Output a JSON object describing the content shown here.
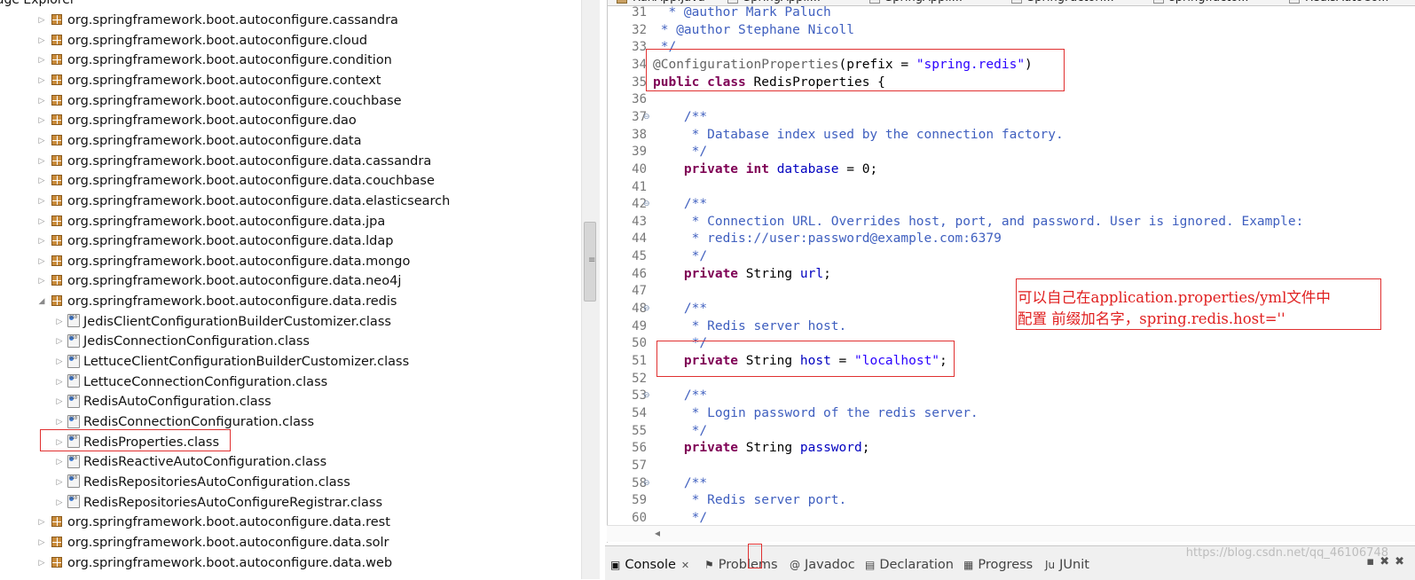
{
  "left_panel": {
    "title": "kage Explorer",
    "tree": [
      {
        "label": "org.springframework.boot.autoconfigure.cassandra",
        "kind": "package",
        "expanded": false
      },
      {
        "label": "org.springframework.boot.autoconfigure.cloud",
        "kind": "package",
        "expanded": false
      },
      {
        "label": "org.springframework.boot.autoconfigure.condition",
        "kind": "package",
        "expanded": false
      },
      {
        "label": "org.springframework.boot.autoconfigure.context",
        "kind": "package",
        "expanded": false
      },
      {
        "label": "org.springframework.boot.autoconfigure.couchbase",
        "kind": "package",
        "expanded": false
      },
      {
        "label": "org.springframework.boot.autoconfigure.dao",
        "kind": "package",
        "expanded": false
      },
      {
        "label": "org.springframework.boot.autoconfigure.data",
        "kind": "package",
        "expanded": false
      },
      {
        "label": "org.springframework.boot.autoconfigure.data.cassandra",
        "kind": "package",
        "expanded": false
      },
      {
        "label": "org.springframework.boot.autoconfigure.data.couchbase",
        "kind": "package",
        "expanded": false
      },
      {
        "label": "org.springframework.boot.autoconfigure.data.elasticsearch",
        "kind": "package",
        "expanded": false
      },
      {
        "label": "org.springframework.boot.autoconfigure.data.jpa",
        "kind": "package",
        "expanded": false
      },
      {
        "label": "org.springframework.boot.autoconfigure.data.ldap",
        "kind": "package",
        "expanded": false
      },
      {
        "label": "org.springframework.boot.autoconfigure.data.mongo",
        "kind": "package",
        "expanded": false
      },
      {
        "label": "org.springframework.boot.autoconfigure.data.neo4j",
        "kind": "package",
        "expanded": false
      },
      {
        "label": "org.springframework.boot.autoconfigure.data.redis",
        "kind": "package",
        "expanded": true
      },
      {
        "label": "JedisClientConfigurationBuilderCustomizer.class",
        "kind": "class",
        "expanded": false
      },
      {
        "label": "JedisConnectionConfiguration.class",
        "kind": "class",
        "expanded": false
      },
      {
        "label": "LettuceClientConfigurationBuilderCustomizer.class",
        "kind": "class",
        "expanded": false
      },
      {
        "label": "LettuceConnectionConfiguration.class",
        "kind": "class",
        "expanded": false
      },
      {
        "label": "RedisAutoConfiguration.class",
        "kind": "class",
        "expanded": false
      },
      {
        "label": "RedisConnectionConfiguration.class",
        "kind": "class",
        "expanded": false
      },
      {
        "label": "RedisProperties.class",
        "kind": "class",
        "expanded": false
      },
      {
        "label": "RedisReactiveAutoConfiguration.class",
        "kind": "class",
        "expanded": false
      },
      {
        "label": "RedisRepositoriesAutoConfiguration.class",
        "kind": "class",
        "expanded": false
      },
      {
        "label": "RedisRepositoriesAutoConfigureRegistrar.class",
        "kind": "class",
        "expanded": false
      },
      {
        "label": "org.springframework.boot.autoconfigure.data.rest",
        "kind": "package",
        "expanded": false
      },
      {
        "label": "org.springframework.boot.autoconfigure.data.solr",
        "kind": "package",
        "expanded": false
      },
      {
        "label": "org.springframework.boot.autoconfigure.data.web",
        "kind": "package",
        "expanded": false
      }
    ]
  },
  "editor": {
    "tabs": [
      "RunApp.java",
      "SpringAppli...",
      "SpringAppli...",
      "SpringFactori...",
      "spring.facto...",
      "RedisAutoCo..."
    ],
    "lines": [
      {
        "n": "31",
        "fold": false,
        "tokens": [
          {
            "t": "  * @author Mark Paluch",
            "c": "cm"
          }
        ]
      },
      {
        "n": "32",
        "fold": false,
        "tokens": [
          {
            "t": " * @author Stephane Nicoll",
            "c": "cm"
          }
        ]
      },
      {
        "n": "33",
        "fold": false,
        "tokens": [
          {
            "t": " */",
            "c": "cm"
          }
        ]
      },
      {
        "n": "34",
        "fold": false,
        "tokens": [
          {
            "t": "@ConfigurationProperties",
            "c": "ann"
          },
          {
            "t": "(prefix = ",
            "c": ""
          },
          {
            "t": "\"spring.redis\"",
            "c": "str"
          },
          {
            "t": ")",
            "c": ""
          }
        ]
      },
      {
        "n": "35",
        "fold": false,
        "tokens": [
          {
            "t": "public",
            "c": "kw"
          },
          {
            "t": " ",
            "c": ""
          },
          {
            "t": "class",
            "c": "kw"
          },
          {
            "t": " RedisProperties {",
            "c": ""
          }
        ]
      },
      {
        "n": "36",
        "fold": false,
        "tokens": []
      },
      {
        "n": "37",
        "fold": true,
        "tokens": [
          {
            "t": "    /**",
            "c": "cm"
          }
        ]
      },
      {
        "n": "38",
        "fold": false,
        "tokens": [
          {
            "t": "     * Database index used by the connection factory.",
            "c": "cm"
          }
        ]
      },
      {
        "n": "39",
        "fold": false,
        "tokens": [
          {
            "t": "     */",
            "c": "cm"
          }
        ]
      },
      {
        "n": "40",
        "fold": false,
        "tokens": [
          {
            "t": "    ",
            "c": ""
          },
          {
            "t": "private",
            "c": "kw"
          },
          {
            "t": " ",
            "c": ""
          },
          {
            "t": "int",
            "c": "kw"
          },
          {
            "t": " ",
            "c": ""
          },
          {
            "t": "database",
            "c": "fld"
          },
          {
            "t": " = 0;",
            "c": ""
          }
        ]
      },
      {
        "n": "41",
        "fold": false,
        "tokens": []
      },
      {
        "n": "42",
        "fold": true,
        "tokens": [
          {
            "t": "    /**",
            "c": "cm"
          }
        ]
      },
      {
        "n": "43",
        "fold": false,
        "tokens": [
          {
            "t": "     * Connection URL. Overrides host, port, and password. User is ignored. Example:",
            "c": "cm"
          }
        ]
      },
      {
        "n": "44",
        "fold": false,
        "tokens": [
          {
            "t": "     * redis://user:password@example.com:6379",
            "c": "cm"
          }
        ]
      },
      {
        "n": "45",
        "fold": false,
        "tokens": [
          {
            "t": "     */",
            "c": "cm"
          }
        ]
      },
      {
        "n": "46",
        "fold": false,
        "tokens": [
          {
            "t": "    ",
            "c": ""
          },
          {
            "t": "private",
            "c": "kw"
          },
          {
            "t": " String ",
            "c": ""
          },
          {
            "t": "url",
            "c": "fld"
          },
          {
            "t": ";",
            "c": ""
          }
        ]
      },
      {
        "n": "47",
        "fold": false,
        "tokens": []
      },
      {
        "n": "48",
        "fold": true,
        "tokens": [
          {
            "t": "    /**",
            "c": "cm"
          }
        ]
      },
      {
        "n": "49",
        "fold": false,
        "tokens": [
          {
            "t": "     * Redis server host.",
            "c": "cm"
          }
        ]
      },
      {
        "n": "50",
        "fold": false,
        "tokens": [
          {
            "t": "     */",
            "c": "cm"
          }
        ]
      },
      {
        "n": "51",
        "fold": false,
        "tokens": [
          {
            "t": "    ",
            "c": ""
          },
          {
            "t": "private",
            "c": "kw"
          },
          {
            "t": " String ",
            "c": ""
          },
          {
            "t": "host",
            "c": "fld"
          },
          {
            "t": " = ",
            "c": ""
          },
          {
            "t": "\"localhost\"",
            "c": "str"
          },
          {
            "t": ";",
            "c": ""
          }
        ]
      },
      {
        "n": "52",
        "fold": false,
        "tokens": []
      },
      {
        "n": "53",
        "fold": true,
        "tokens": [
          {
            "t": "    /**",
            "c": "cm"
          }
        ]
      },
      {
        "n": "54",
        "fold": false,
        "tokens": [
          {
            "t": "     * Login password of the redis server.",
            "c": "cm"
          }
        ]
      },
      {
        "n": "55",
        "fold": false,
        "tokens": [
          {
            "t": "     */",
            "c": "cm"
          }
        ]
      },
      {
        "n": "56",
        "fold": false,
        "tokens": [
          {
            "t": "    ",
            "c": ""
          },
          {
            "t": "private",
            "c": "kw"
          },
          {
            "t": " String ",
            "c": ""
          },
          {
            "t": "password",
            "c": "fld"
          },
          {
            "t": ";",
            "c": ""
          }
        ]
      },
      {
        "n": "57",
        "fold": false,
        "tokens": []
      },
      {
        "n": "58",
        "fold": true,
        "tokens": [
          {
            "t": "    /**",
            "c": "cm"
          }
        ]
      },
      {
        "n": "59",
        "fold": false,
        "tokens": [
          {
            "t": "     * Redis server port.",
            "c": "cm"
          }
        ]
      },
      {
        "n": "60",
        "fold": false,
        "tokens": [
          {
            "t": "     */",
            "c": "cm"
          }
        ]
      }
    ]
  },
  "note": {
    "line1": "可以自己在application.properties/yml文件中",
    "line2": "配置 前缀加名字，spring.redis.host=''"
  },
  "bottom": {
    "tabs": [
      {
        "label": "Console",
        "icon": "console-icon",
        "active": true,
        "closable": true
      },
      {
        "label": "Problems",
        "icon": "problems-icon",
        "active": false,
        "closable": false
      },
      {
        "label": "Javadoc",
        "icon": "javadoc-icon",
        "active": false,
        "closable": false
      },
      {
        "label": "Declaration",
        "icon": "declaration-icon",
        "active": false,
        "closable": false
      },
      {
        "label": "Progress",
        "icon": "progress-icon",
        "active": false,
        "closable": false
      },
      {
        "label": "JUnit",
        "icon": "junit-icon",
        "active": false,
        "closable": false
      }
    ],
    "watermark": "https://blog.csdn.net/qq_46106748"
  },
  "colors": {
    "highlight_box": "#e03030",
    "keyword": "#7f0055",
    "comment": "#3f5fbf",
    "string": "#2a00ff",
    "field": "#0000c0"
  }
}
